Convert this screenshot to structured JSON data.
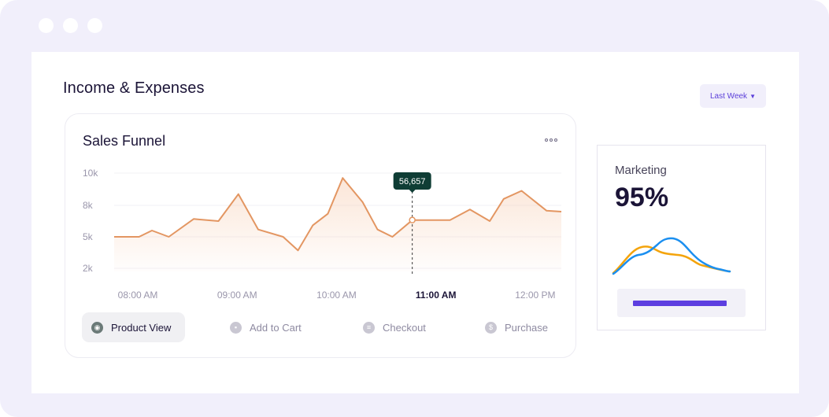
{
  "window": {
    "dots": 3
  },
  "page": {
    "title": "Income & Expenses"
  },
  "range": {
    "label": "Last Week"
  },
  "card": {
    "title": "Sales Funnel",
    "more_icon": "more-horizontal-icon"
  },
  "chart_data": {
    "type": "area",
    "ylim": [
      2000,
      10000
    ],
    "y_ticks": [
      {
        "label": "10k",
        "value": 10000
      },
      {
        "label": "8k",
        "value": 8000
      },
      {
        "label": "5k",
        "value": 5000
      },
      {
        "label": "2k",
        "value": 2000
      }
    ],
    "x_ticks": [
      "08:00 AM",
      "09:00 AM",
      "10:00 AM",
      "11:00 AM",
      "12:00 PM"
    ],
    "active_tick": "11:00 AM",
    "x": [
      8.0,
      8.25,
      8.38,
      8.55,
      8.8,
      9.05,
      9.25,
      9.45,
      9.7,
      9.85,
      10.0,
      10.15,
      10.3,
      10.5,
      10.65,
      10.8,
      11.0,
      11.2,
      11.38,
      11.58,
      11.78,
      11.92,
      12.1,
      12.35,
      12.5
    ],
    "series": [
      {
        "color": "#e39662",
        "values": [
          5000,
          5000,
          5600,
          5000,
          6700,
          6500,
          8700,
          5700,
          5000,
          3700,
          6100,
          7200,
          9700,
          8200,
          5700,
          5000,
          6600,
          6600,
          6600,
          7600,
          6500,
          8400,
          8900,
          7500,
          7400
        ]
      }
    ],
    "tooltip": {
      "x": 11.0,
      "value": 6600,
      "label": "56,657"
    }
  },
  "legend": [
    {
      "label": "Product View",
      "icon": "eye-icon",
      "glyph": "◉",
      "active": true
    },
    {
      "label": "Add to Cart",
      "icon": "bag-icon",
      "glyph": "▪",
      "active": false
    },
    {
      "label": "Checkout",
      "icon": "receipt-icon",
      "glyph": "≡",
      "active": false
    },
    {
      "label": "Purchase",
      "icon": "dollar-icon",
      "glyph": "$",
      "active": false
    }
  ],
  "marketing": {
    "label": "Marketing",
    "value": "95%",
    "progress": 0.95,
    "colors": {
      "orange": "#f4a40c",
      "blue": "#1b8ff0",
      "bar": "#5d3fe0"
    }
  }
}
